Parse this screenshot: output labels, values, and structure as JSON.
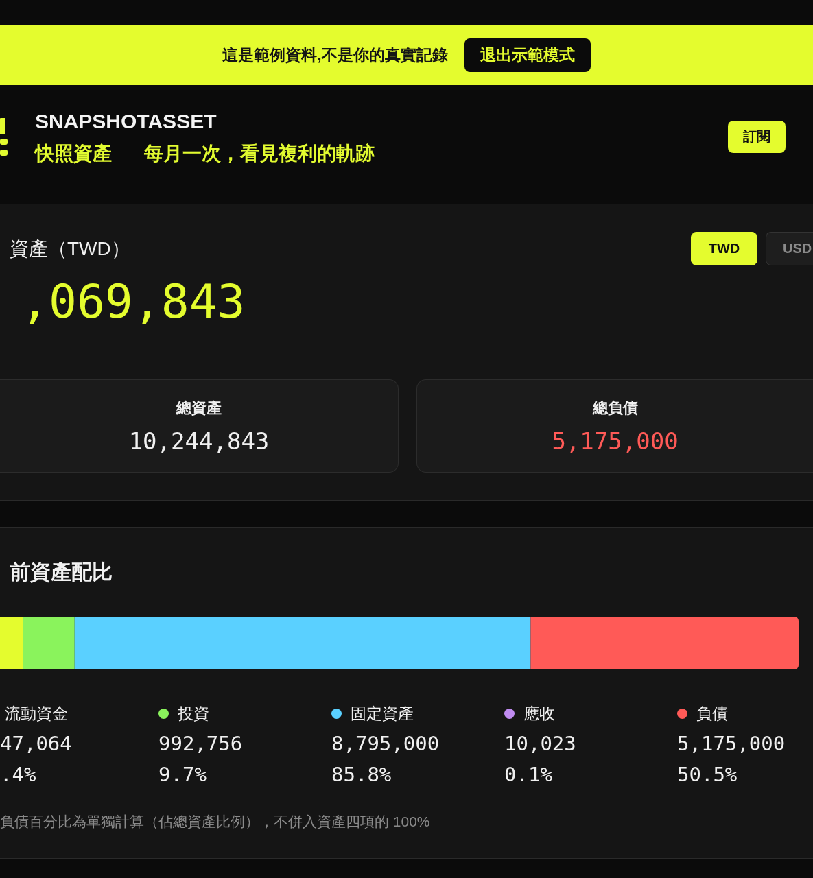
{
  "demo_banner": {
    "message": "這是範例資料,不是你的真實記錄",
    "exit_button": "退出示範模式"
  },
  "app_header": {
    "title": "SNAPSHOTASSET",
    "name": "快照資產",
    "tagline": "每月一次，看見複利的軌跡",
    "subscribe_button": "訂閱"
  },
  "net_worth": {
    "label": "資產（TWD）",
    "value": ",069,843",
    "currencies": [
      {
        "label": "TWD",
        "selected": true
      },
      {
        "label": "USD",
        "selected": false
      }
    ]
  },
  "totals": [
    {
      "kind": "asset",
      "label": "總資產",
      "value": "10,244,843"
    },
    {
      "kind": "liability",
      "label": "總負債",
      "value": "5,175,000"
    }
  ],
  "allocation": {
    "title": "前資產配比",
    "legend": [
      {
        "label": "流動資金",
        "amount": "47,064",
        "percent": ".4%"
      },
      {
        "label": "投資",
        "amount": "992,756",
        "percent": "9.7%",
        "color": "#8af35c"
      },
      {
        "label": "固定資產",
        "amount": "8,795,000",
        "percent": "85.8%",
        "color": "#5ad0ff"
      },
      {
        "label": "應收",
        "amount": "10,023",
        "percent": "0.1%",
        "color": "#c08bf0"
      },
      {
        "label": "負債",
        "amount": "5,175,000",
        "percent": "50.5%",
        "color": "#ff5a57"
      }
    ],
    "note": "負債百分比為單獨計算（佔總資產比例），不併入資產四項的 100%"
  }
}
